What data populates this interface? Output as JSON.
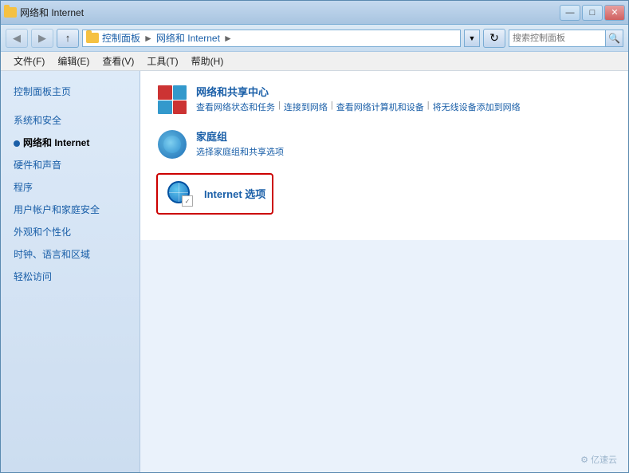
{
  "window": {
    "title": "网络和 Internet",
    "titlebar_buttons": {
      "minimize": "—",
      "maximize": "□",
      "close": "✕"
    }
  },
  "addressbar": {
    "path_parts": [
      "控制面板",
      "网络和 Internet"
    ],
    "search_placeholder": "搜索控制面板",
    "refresh": "↺"
  },
  "menubar": {
    "items": [
      "文件(F)",
      "编辑(E)",
      "查看(V)",
      "工具(T)",
      "帮助(H)"
    ]
  },
  "sidebar": {
    "items": [
      {
        "label": "控制面板主页",
        "active": false,
        "dot": false
      },
      {
        "label": "系统和安全",
        "active": false,
        "dot": false
      },
      {
        "label": "网络和 Internet",
        "active": true,
        "dot": true
      },
      {
        "label": "硬件和声音",
        "active": false,
        "dot": false
      },
      {
        "label": "程序",
        "active": false,
        "dot": false
      },
      {
        "label": "用户帐户和家庭安全",
        "active": false,
        "dot": false
      },
      {
        "label": "外观和个性化",
        "active": false,
        "dot": false
      },
      {
        "label": "时钟、语言和区域",
        "active": false,
        "dot": false
      },
      {
        "label": "轻松访问",
        "active": false,
        "dot": false
      }
    ]
  },
  "content": {
    "items": [
      {
        "id": "network-sharing",
        "title": "网络和共享中心",
        "links": [
          "查看网络状态和任务",
          "连接到网络",
          "查看网络计算机和设备",
          "将无线设备添加到网络"
        ],
        "highlighted": false
      },
      {
        "id": "homegroup",
        "title": "家庭组",
        "links": [
          "选择家庭组和共享选项"
        ],
        "highlighted": false
      },
      {
        "id": "internet-options",
        "title": "Internet 选项",
        "links": [],
        "highlighted": true
      }
    ]
  },
  "watermark": "⚙ 亿速云"
}
